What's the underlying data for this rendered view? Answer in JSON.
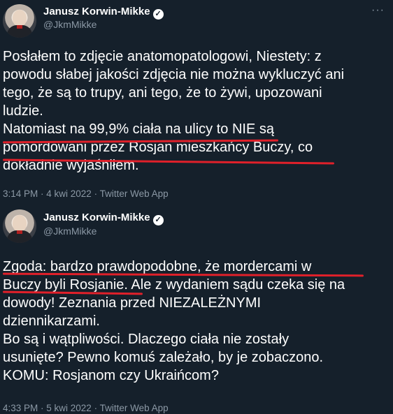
{
  "tweets": [
    {
      "author": "Janusz Korwin-Mikke",
      "handle": "@JkmMikke",
      "lines": [
        "Posłałem to zdjęcie anatomopatologowi, Niestety: z",
        "powodu słabej jakości zdjęcia nie można wykluczyć ani",
        "tego, że są to trupy, ani tego, że to żywi, upozowani",
        "ludzie.",
        "Natomiast na 99,9% ciała na ulicy to NIE są",
        "pomordowani przez Rosjan mieszkańcy Buczy, co",
        "dokładnie wyjaśniłem."
      ],
      "meta": "3:14 PM · 4 kwi 2022 · Twitter Web App"
    },
    {
      "author": "Janusz Korwin-Mikke",
      "handle": "@JkmMikke",
      "lines": [
        "Zgoda: bardzo prawdopodobne, że mordercami w",
        "Buczy byli Rosjanie. Ale z wydaniem sądu czeka się na",
        "dowody! Zeznania przed NIEZALEŻNYMI",
        "dziennikarzami.",
        "Bo są i wątpliwości. Dlaczego ciała nie zostały",
        "usunięte? Pewno komuś zależało, by je zobaczono.",
        "KOMU: Rosjanom czy Ukraińcom?"
      ],
      "meta": "4:33 PM · 5 kwi 2022 · Twitter Web App"
    }
  ],
  "icons": {
    "verified": "verified-badge-icon",
    "more": "more-options-icon"
  },
  "colors": {
    "background": "#15202b",
    "text": "#ffffff",
    "secondary_text": "#8b98a5",
    "underline": "#e0202a"
  }
}
